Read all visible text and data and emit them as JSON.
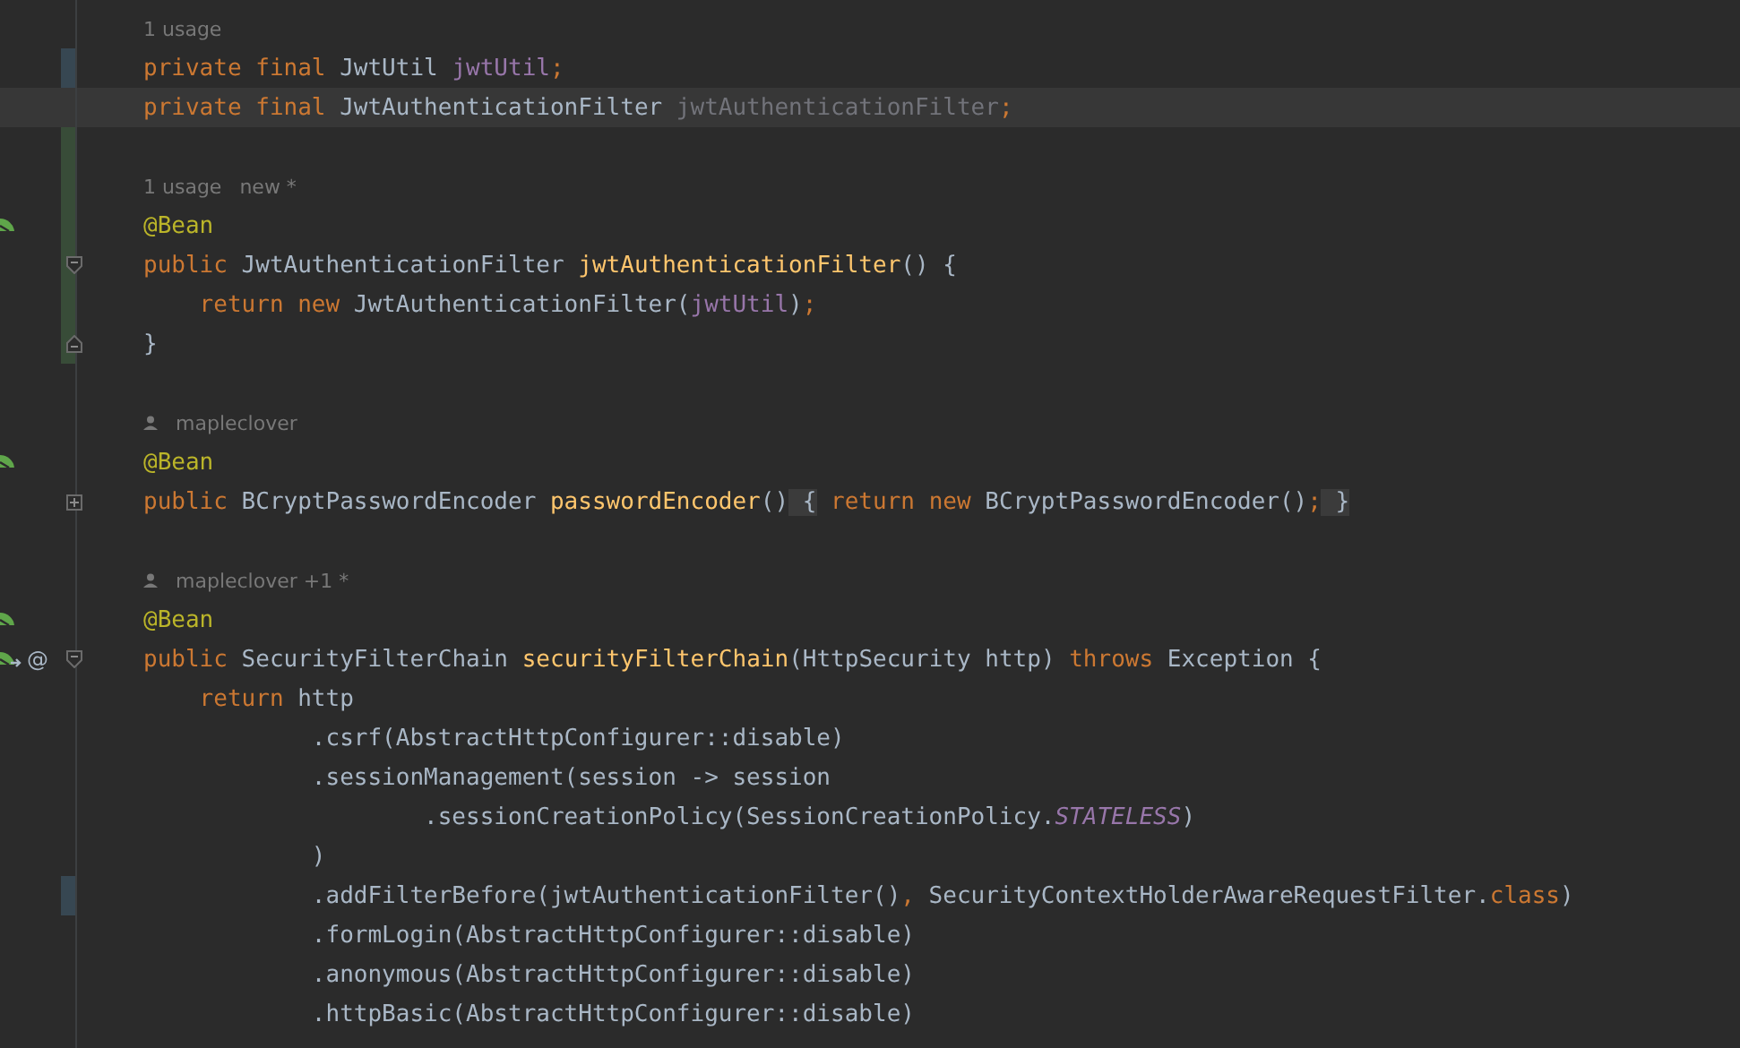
{
  "editor": {
    "lines": [
      {
        "kind": "hint",
        "hints": [
          "1 usage"
        ]
      },
      {
        "kind": "code",
        "change": {
          "color": "#374752"
        },
        "tokens": [
          {
            "t": "private final ",
            "kind": "keyword"
          },
          {
            "t": "JwtUtil ",
            "kind": "plain"
          },
          {
            "t": "jwtUtil",
            "kind": "field"
          },
          {
            "t": ";",
            "kind": "keyword"
          }
        ]
      },
      {
        "kind": "code",
        "current": true,
        "tokens": [
          {
            "t": "private final ",
            "kind": "keyword"
          },
          {
            "t": "JwtAuthenticationFilter ",
            "kind": "plain"
          },
          {
            "t": "jwtAuthenticationFilter",
            "kind": "unused"
          },
          {
            "t": ";",
            "kind": "keyword"
          }
        ]
      },
      {
        "kind": "blank",
        "change": {
          "color": "#384c38"
        }
      },
      {
        "kind": "hint",
        "change": {
          "color": "#384c38"
        },
        "hints": [
          "1 usage",
          "new *"
        ]
      },
      {
        "kind": "code",
        "change": {
          "color": "#384c38"
        },
        "gutter_icons": [
          {
            "kind": "bean"
          }
        ],
        "tokens": [
          {
            "t": "@Bean",
            "kind": "annotation"
          }
        ]
      },
      {
        "kind": "code",
        "change": {
          "color": "#384c38"
        },
        "fold": {
          "kind": "start"
        },
        "tokens": [
          {
            "t": "public ",
            "kind": "keyword"
          },
          {
            "t": "JwtAuthenticationFilter ",
            "kind": "plain"
          },
          {
            "t": "jwtAuthenticationFilter",
            "kind": "method"
          },
          {
            "t": "() {",
            "kind": "plain"
          }
        ]
      },
      {
        "kind": "code",
        "change": {
          "color": "#384c38"
        },
        "tokens": [
          {
            "t": "    return new ",
            "kind": "keyword"
          },
          {
            "t": "JwtAuthenticationFilter(",
            "kind": "plain"
          },
          {
            "t": "jwtUtil",
            "kind": "field"
          },
          {
            "t": ")",
            "kind": "plain"
          },
          {
            "t": ";",
            "kind": "keyword"
          }
        ]
      },
      {
        "kind": "code",
        "change": {
          "color": "#384c38"
        },
        "fold": {
          "kind": "end"
        },
        "tokens": [
          {
            "t": "}",
            "kind": "plain"
          }
        ]
      },
      {
        "kind": "blank"
      },
      {
        "kind": "hint",
        "author": true,
        "hints": [
          "mapleclover"
        ]
      },
      {
        "kind": "code",
        "gutter_icons": [
          {
            "kind": "bean"
          }
        ],
        "tokens": [
          {
            "t": "@Bean",
            "kind": "annotation"
          }
        ]
      },
      {
        "kind": "code",
        "fold": {
          "kind": "collapsed"
        },
        "tokens": [
          {
            "t": "public ",
            "kind": "keyword"
          },
          {
            "t": "BCryptPasswordEncoder ",
            "kind": "plain"
          },
          {
            "t": "passwordEncoder",
            "kind": "method"
          },
          {
            "t": "()",
            "kind": "plain"
          },
          {
            "t": " {",
            "kind": "folded"
          },
          {
            "t": " return new ",
            "kind": "keyword"
          },
          {
            "t": "BCryptPasswordEncoder()",
            "kind": "plain"
          },
          {
            "t": ";",
            "kind": "keyword"
          },
          {
            "t": " }",
            "kind": "folded"
          }
        ]
      },
      {
        "kind": "blank"
      },
      {
        "kind": "hint",
        "author": true,
        "hints": [
          "mapleclover +1 *"
        ]
      },
      {
        "kind": "code",
        "gutter_icons": [
          {
            "kind": "bean"
          }
        ],
        "tokens": [
          {
            "t": "@Bean",
            "kind": "annotation"
          }
        ]
      },
      {
        "kind": "code",
        "gutter_icons": [
          {
            "kind": "bean-arrow"
          }
        ],
        "gutter_label": "@",
        "fold": {
          "kind": "start"
        },
        "tokens": [
          {
            "t": "public ",
            "kind": "keyword"
          },
          {
            "t": "SecurityFilterChain ",
            "kind": "plain"
          },
          {
            "t": "securityFilterChain",
            "kind": "method"
          },
          {
            "t": "(HttpSecurity http) ",
            "kind": "plain"
          },
          {
            "t": "throws ",
            "kind": "keyword"
          },
          {
            "t": "Exception {",
            "kind": "plain"
          }
        ]
      },
      {
        "kind": "code",
        "tokens": [
          {
            "t": "    return ",
            "kind": "keyword"
          },
          {
            "t": "http",
            "kind": "plain"
          }
        ]
      },
      {
        "kind": "code",
        "tokens": [
          {
            "t": "            .csrf(AbstractHttpConfigurer::disable)",
            "kind": "plain"
          }
        ]
      },
      {
        "kind": "code",
        "tokens": [
          {
            "t": "            .sessionManagement(session -> session",
            "kind": "plain"
          }
        ]
      },
      {
        "kind": "code",
        "tokens": [
          {
            "t": "                    .sessionCreationPolicy(SessionCreationPolicy.",
            "kind": "plain"
          },
          {
            "t": "STATELESS",
            "kind": "static"
          },
          {
            "t": ")",
            "kind": "plain"
          }
        ]
      },
      {
        "kind": "code",
        "tokens": [
          {
            "t": "            )",
            "kind": "plain"
          }
        ]
      },
      {
        "kind": "code",
        "change": {
          "color": "#374752"
        },
        "tokens": [
          {
            "t": "            .addFilterBefore(jwtAuthenticationFilter()",
            "kind": "plain"
          },
          {
            "t": ", ",
            "kind": "keyword"
          },
          {
            "t": "SecurityContextHolderAwareRequestFilter.",
            "kind": "plain"
          },
          {
            "t": "class",
            "kind": "keyword"
          },
          {
            "t": ")",
            "kind": "plain"
          }
        ]
      },
      {
        "kind": "code",
        "tokens": [
          {
            "t": "            .formLogin(AbstractHttpConfigurer::disable)",
            "kind": "plain"
          }
        ]
      },
      {
        "kind": "code",
        "tokens": [
          {
            "t": "            .anonymous(AbstractHttpConfigurer::disable)",
            "kind": "plain"
          }
        ]
      },
      {
        "kind": "code",
        "tokens": [
          {
            "t": "            .httpBasic(AbstractHttpConfigurer::disable)",
            "kind": "plain"
          }
        ]
      }
    ]
  }
}
